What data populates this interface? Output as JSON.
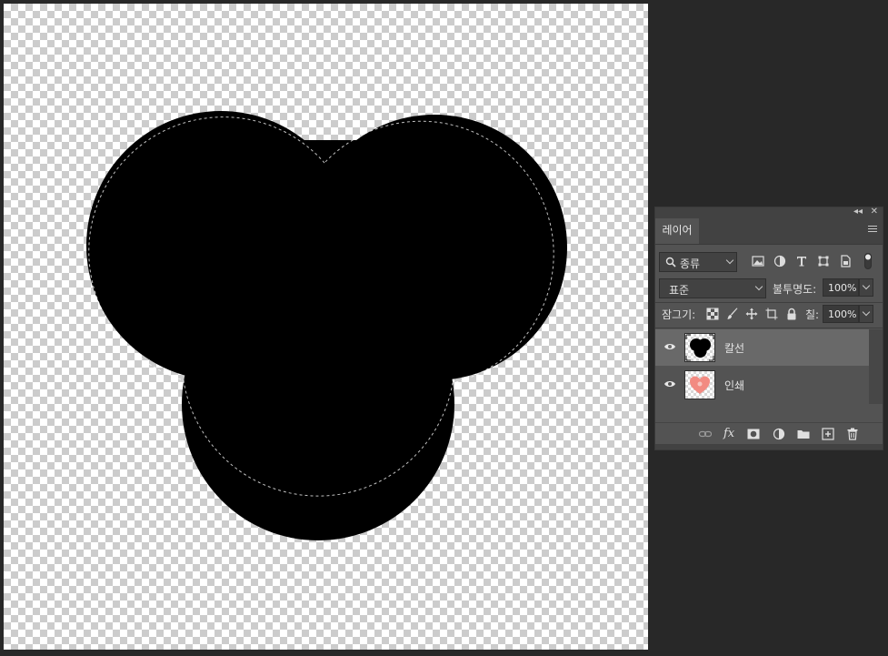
{
  "panel": {
    "collapse_icon": "double-chevron-left-icon",
    "close_icon": "close-icon",
    "tab_label": "레이어",
    "menu_icon": "hamburger-menu-icon"
  },
  "filter": {
    "kind_label": "종류",
    "icons": [
      "image-filter-icon",
      "adjustment-filter-icon",
      "type-filter-icon",
      "shape-filter-icon",
      "smart-object-filter-icon",
      "filter-toggle-icon"
    ]
  },
  "blend": {
    "mode": "표준",
    "opacity_label": "불투명도:",
    "opacity_value": "100%"
  },
  "lock": {
    "label": "잠그기:",
    "icons": [
      "lock-transparent-pixels-icon",
      "lock-image-pixels-icon",
      "lock-position-icon",
      "lock-artboard-icon",
      "lock-all-icon"
    ],
    "fill_label": "칠:",
    "fill_value": "100%"
  },
  "layers": [
    {
      "name": "칼선",
      "selected": true,
      "visible": true,
      "thumb": "black-trefoil-shape"
    },
    {
      "name": "인쇄",
      "selected": false,
      "visible": true,
      "thumb": "pink-heart-shape"
    }
  ],
  "bottom_icons": [
    "link-layers-icon",
    "fx-icon",
    "add-mask-icon",
    "adjustment-layer-icon",
    "group-folder-icon",
    "new-layer-icon",
    "trash-icon"
  ],
  "colors": {
    "panel_bg": "#535353",
    "selected_row": "#696969",
    "workspace": "#282828",
    "shape_fill": "#000000",
    "heart": "#f28b82"
  }
}
